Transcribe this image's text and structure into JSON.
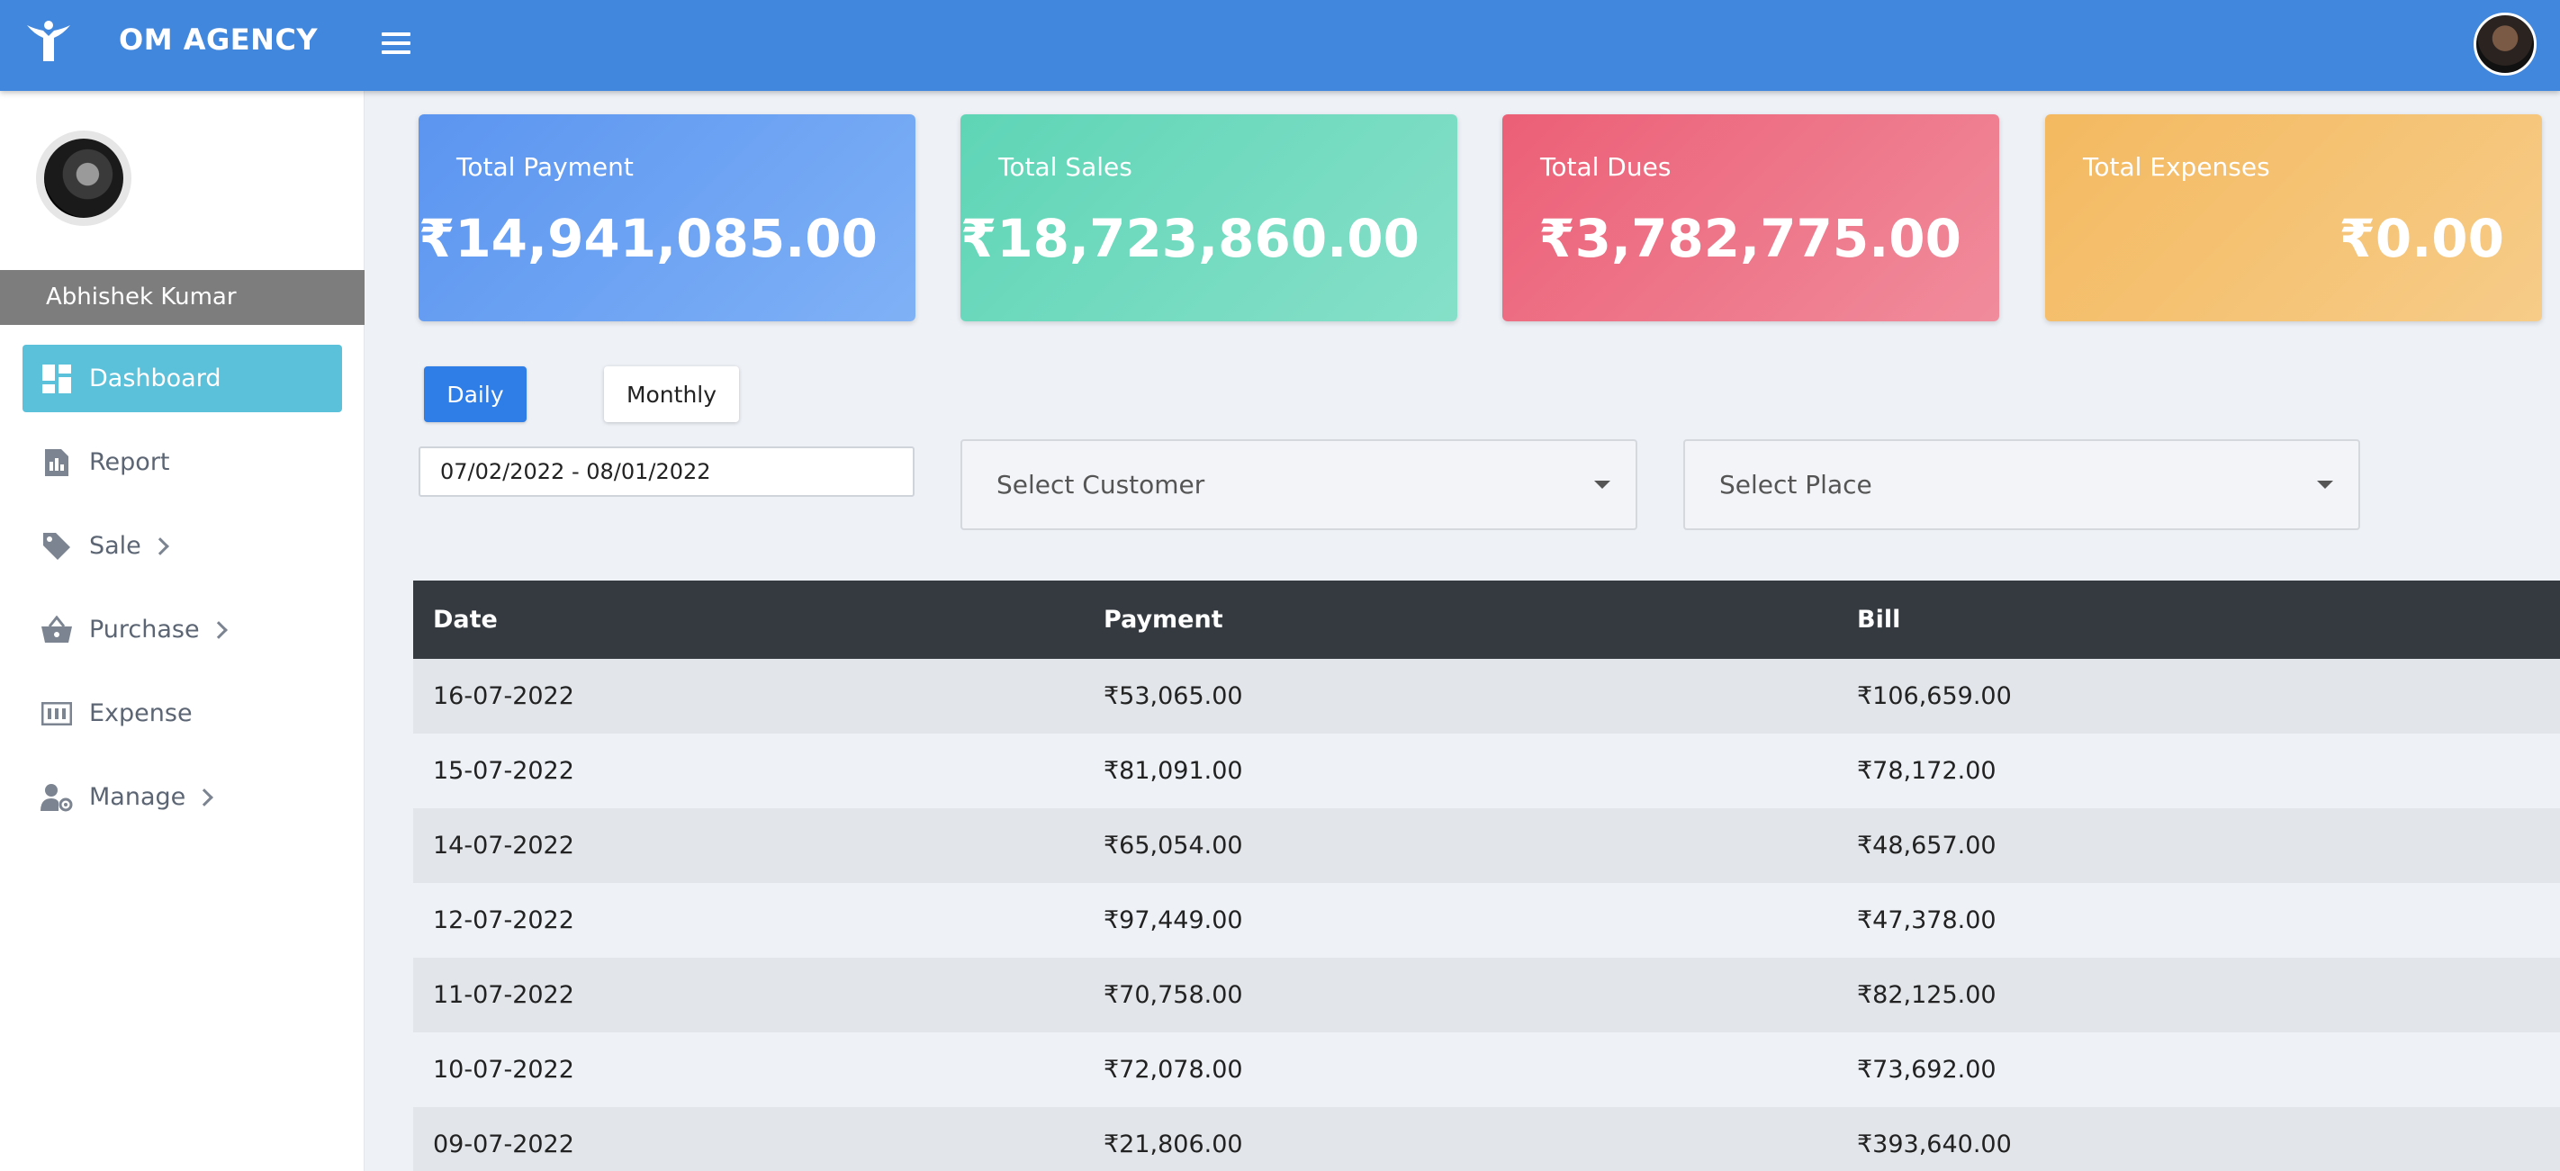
{
  "header": {
    "brand": "OM AGENCY",
    "logo_icon": "yoga-logo-icon",
    "menu_icon": "hamburger-icon"
  },
  "sidebar": {
    "user_name": "Abhishek Kumar",
    "items": [
      {
        "label": "Dashboard",
        "icon": "dashboard-icon",
        "active": true,
        "has_submenu": false
      },
      {
        "label": "Report",
        "icon": "report-icon",
        "active": false,
        "has_submenu": false
      },
      {
        "label": "Sale",
        "icon": "tag-icon",
        "active": false,
        "has_submenu": true
      },
      {
        "label": "Purchase",
        "icon": "basket-icon",
        "active": false,
        "has_submenu": true
      },
      {
        "label": "Expense",
        "icon": "money-icon",
        "active": false,
        "has_submenu": false
      },
      {
        "label": "Manage",
        "icon": "user-gear-icon",
        "active": false,
        "has_submenu": true
      }
    ]
  },
  "cards": {
    "payment": {
      "label": "Total Payment",
      "value": "₹14,941,085.00",
      "color": "#5b95f0"
    },
    "sales": {
      "label": "Total Sales",
      "value": "₹18,723,860.00",
      "color": "#5fd5b6"
    },
    "dues": {
      "label": "Total Dues",
      "value": "₹3,782,775.00",
      "color": "#ec5f76"
    },
    "expenses": {
      "label": "Total Expenses",
      "value": "₹0.00",
      "color": "#f4b960"
    }
  },
  "filters": {
    "daily_label": "Daily",
    "monthly_label": "Monthly",
    "date_range": "07/02/2022 - 08/01/2022",
    "customer_placeholder": "Select Customer",
    "place_placeholder": "Select Place"
  },
  "table": {
    "headers": [
      "Date",
      "Payment",
      "Bill"
    ],
    "rows": [
      [
        "16-07-2022",
        "₹53,065.00",
        "₹106,659.00"
      ],
      [
        "15-07-2022",
        "₹81,091.00",
        "₹78,172.00"
      ],
      [
        "14-07-2022",
        "₹65,054.00",
        "₹48,657.00"
      ],
      [
        "12-07-2022",
        "₹97,449.00",
        "₹47,378.00"
      ],
      [
        "11-07-2022",
        "₹70,758.00",
        "₹82,125.00"
      ],
      [
        "10-07-2022",
        "₹72,078.00",
        "₹73,692.00"
      ],
      [
        "09-07-2022",
        "₹21,806.00",
        "₹393,640.00"
      ]
    ]
  }
}
